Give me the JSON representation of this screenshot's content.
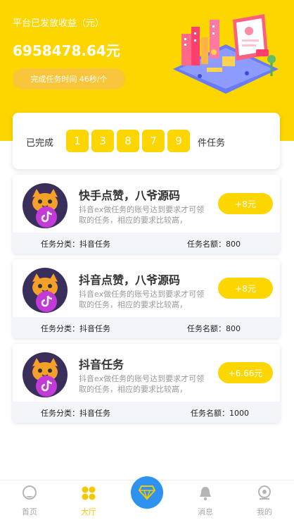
{
  "hero": {
    "label": "平台已发放收益（元）",
    "amount": "6958478.64元",
    "pill": "完成任务时间 46秒/个",
    "illustration_icon": "isometric-city-illustration"
  },
  "progress": {
    "prefix": "已完成",
    "digits": [
      "1",
      "3",
      "8",
      "7",
      "9"
    ],
    "suffix": "件任务"
  },
  "tasks": [
    {
      "title": "快手点赞，八爷源码",
      "desc": "抖音ex做任务的账号达到要求才可领取的任务，相应的要求比较高，",
      "reward": "+8元",
      "category": "任务分类：抖音任务",
      "quota": "任务名额：800"
    },
    {
      "title": "抖音点赞，八爷源码",
      "desc": "抖音ex做任务的账号达到要求才可领取的任务，相应的要求比较高，",
      "reward": "+8元",
      "category": "任务分类：抖音任务",
      "quota": "任务名额：800"
    },
    {
      "title": "抖音任务",
      "desc": "抖音ex做任务的账号达到要求才可领取的任务，相应的要求比较高，",
      "reward": "+6.66元",
      "category": "任务分类：抖音任务",
      "quota": "任务名额：1000"
    }
  ],
  "tabbar": {
    "items": [
      {
        "label": "首页",
        "icon": "home-icon",
        "active": false
      },
      {
        "label": "大厅",
        "icon": "hall-grid-icon",
        "active": true
      },
      {
        "label": "",
        "icon": "diamond-icon",
        "active": false
      },
      {
        "label": "消息",
        "icon": "bell-icon",
        "active": false
      },
      {
        "label": "我的",
        "icon": "profile-icon",
        "active": false
      }
    ]
  },
  "colors": {
    "brand_yellow": "#fdd600",
    "center_blue": "#2e93f0",
    "active_tab": "#f6c800"
  }
}
